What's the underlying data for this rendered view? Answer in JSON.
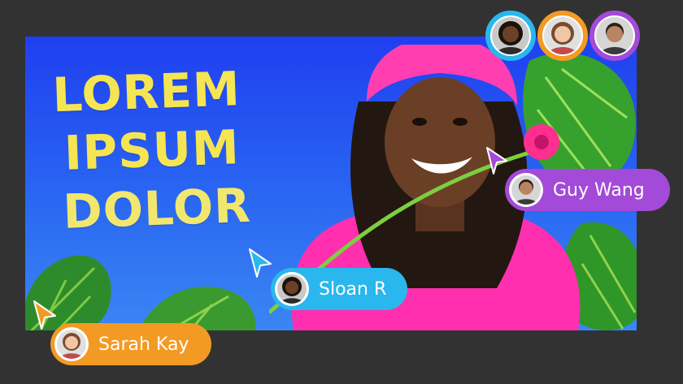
{
  "canvas": {
    "headline": [
      "LOREM",
      "IPSUM",
      "DOLOR"
    ]
  },
  "collaborators": [
    {
      "ring": "#29b7ee",
      "skin": "#6b4228",
      "hair": "#1c120c"
    },
    {
      "ring": "#f39a24",
      "skin": "#f0c6a8",
      "hair": "#7a4a2c"
    },
    {
      "ring": "#a34ad8",
      "skin": "#b98463",
      "hair": "#2a211b"
    }
  ],
  "tags": [
    {
      "name": "Guy Wang",
      "color": "#a34ad8"
    },
    {
      "name": "Sloan R",
      "color": "#29b7ee"
    },
    {
      "name": "Sarah Kay",
      "color": "#f39a24"
    }
  ],
  "colors": {
    "background": "#323232",
    "sky": "#1f3ff0",
    "headline": "#f5e553",
    "hat": "#ff3fb1",
    "leaf": "#2f8a2a"
  },
  "icons": [
    "cursor-arrow-icon",
    "avatar-icon",
    "monstera-leaf-icon",
    "flower-icon"
  ]
}
